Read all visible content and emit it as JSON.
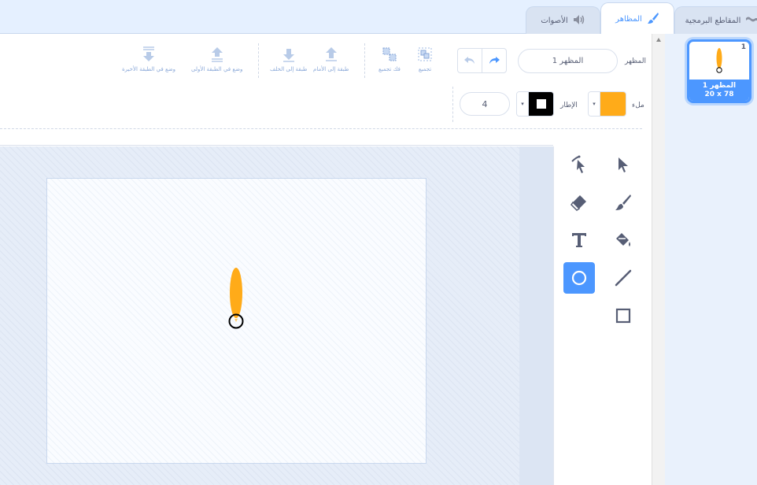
{
  "tabs": [
    {
      "label": "المقاطع البرمجية",
      "icon": "code-icon",
      "active": false
    },
    {
      "label": "المظاهر",
      "icon": "brush-icon",
      "active": true
    },
    {
      "label": "الأصوات",
      "icon": "speaker-icon",
      "active": false
    }
  ],
  "costume_panel": {
    "name_label": "المظهر",
    "name_value": "المظهر 1",
    "actions": {
      "group": "تجميع",
      "ungroup": "فك تجميع",
      "forward": "طبقة إلى الأمام",
      "backward": "طبقة إلى الخلف",
      "front": "وضع في الطبقة الأولى",
      "back": "وضع في الطبقة الأخيرة"
    },
    "fill_label": "ملء",
    "outline_label": "الإطار",
    "outline_width": "4",
    "fill_color": "#ffab19",
    "outline_color": "#000000"
  },
  "costume_list": [
    {
      "number": "1",
      "name": "المظهر 1",
      "size": "20 x 78",
      "selected": true
    }
  ],
  "tools": [
    {
      "name": "select-icon",
      "active": false
    },
    {
      "name": "reshape-icon",
      "active": false
    },
    {
      "name": "brush-icon",
      "active": false
    },
    {
      "name": "eraser-icon",
      "active": false
    },
    {
      "name": "fill-icon",
      "active": false
    },
    {
      "name": "text-icon",
      "active": false
    },
    {
      "name": "line-icon",
      "active": false
    },
    {
      "name": "circle-icon",
      "active": true
    },
    {
      "name": "rectangle-icon",
      "active": false
    }
  ],
  "colors": {
    "accent": "#4c97ff",
    "fill": "#ffab19"
  }
}
